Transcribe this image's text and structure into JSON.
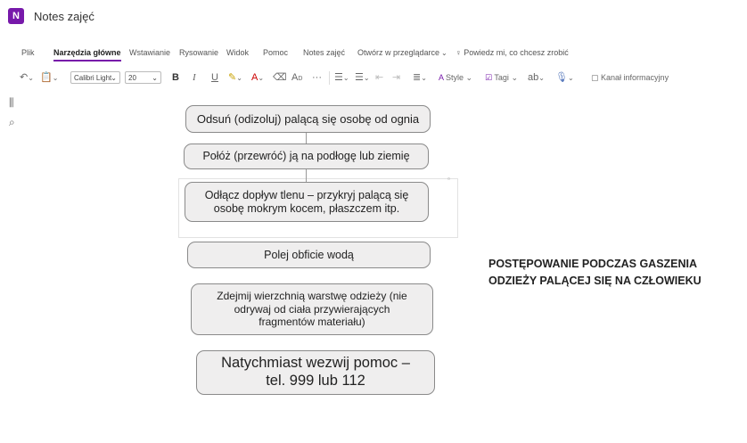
{
  "app": {
    "title": "Notes zajęć",
    "icon_letter": "N"
  },
  "ribbon_tabs": [
    {
      "label": "Plik"
    },
    {
      "label": "Narzędzia główne",
      "active": true
    },
    {
      "label": "Wstawianie"
    },
    {
      "label": "Rysowanie"
    },
    {
      "label": "Widok"
    },
    {
      "label": "Pomoc"
    },
    {
      "label": "Notes zajęć"
    },
    {
      "label": "Otwórz w przeglądarce"
    }
  ],
  "search_hint": "Powiedz mi, co chcesz zrobić",
  "toolbar": {
    "font_name": "Calibri Light",
    "font_size": "20",
    "bold": "B",
    "italic": "I",
    "underline": "U",
    "more": "···",
    "style_label": "Style",
    "tags_label": "Tagi",
    "feed_label": "Kanał informacyjny"
  },
  "steps": [
    "Odsuń (odizoluj) palącą się osobę od ognia",
    "Połóż (przewróć) ją na podłogę lub ziemię",
    "Odłącz dopływ tlenu – przykryj palącą się osobę mokrym kocem, płaszczem itp.",
    "Polej obficie wodą",
    "Zdejmij wierzchnią warstwę odzieży (nie odrywaj od ciała przywierających fragmentów materiału)",
    "Natychmiast wezwij pomoc – tel. 999 lub 112"
  ],
  "heading": "POSTĘPOWANIE PODCZAS GASZENIA ODZIEŻY PALĄCEJ SIĘ NA CZŁOWIEKU",
  "colors": {
    "accent": "#7719aa",
    "box_fill": "#efeeee",
    "box_border": "#8a8a8a"
  },
  "icons": [
    "library-icon",
    "search-icon",
    "undo-icon",
    "clipboard-icon",
    "highlighter-icon",
    "font-color-icon",
    "eraser-icon",
    "text-effects-icon",
    "bullets-icon",
    "numbering-icon",
    "outdent-icon",
    "indent-icon",
    "align-icon",
    "style-icon",
    "tags-icon",
    "spelling-icon",
    "dictate-icon",
    "feed-icon",
    "lightbulb-icon"
  ]
}
